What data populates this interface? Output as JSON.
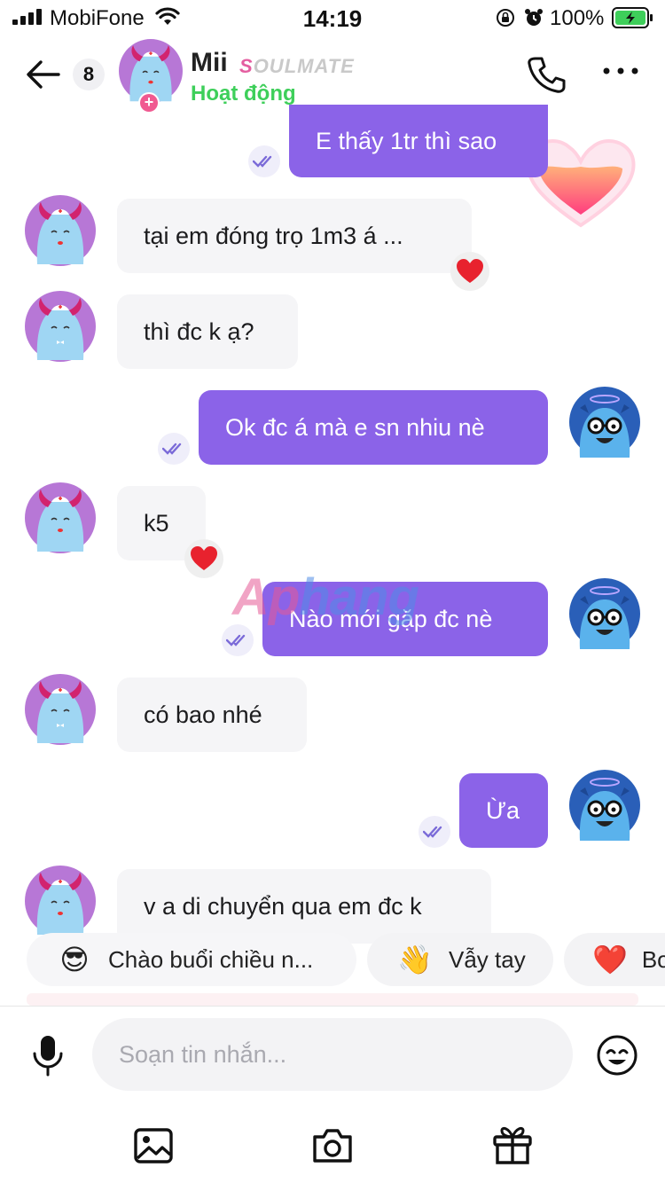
{
  "status_bar": {
    "carrier": "MobiFone",
    "time": "14:19",
    "battery": "100%"
  },
  "header": {
    "unread_count": "8",
    "name": "Mii",
    "tag_prefix": "S",
    "tag_rest": "OULMATE",
    "status": "Hoạt động"
  },
  "messages": [
    {
      "side": "out",
      "text": "E thấy 1tr thì sao",
      "seen": true
    },
    {
      "side": "in",
      "text": "tại em đóng trọ 1m3 á ...",
      "reaction": "❤️"
    },
    {
      "side": "in",
      "text": "thì đc k ạ?"
    },
    {
      "side": "out",
      "text": "Ok đc á mà e sn nhiu nè",
      "seen": true
    },
    {
      "side": "in",
      "text": "k5",
      "reaction": "❤️"
    },
    {
      "side": "out",
      "text": "Nào mới gặp đc nè",
      "seen": true
    },
    {
      "side": "in",
      "text": "có bao nhé"
    },
    {
      "side": "out",
      "text": "Ừa",
      "seen": true
    },
    {
      "side": "in",
      "text": "v a di chuyển qua em đc k"
    }
  ],
  "watermark": {
    "part1": "Ap",
    "part2": "hang"
  },
  "quick_replies": [
    {
      "icon": "sun-sunglasses-icon",
      "emoji": "😎",
      "label": "Chào buổi chiều n..."
    },
    {
      "icon": "waving-hand-icon",
      "emoji": "👋",
      "label": "Vẫy tay"
    },
    {
      "icon": "heart-icon",
      "emoji": "❤️",
      "label": "Bo"
    }
  ],
  "composer": {
    "placeholder": "Soạn tin nhắn..."
  },
  "colors": {
    "accent": "#8b63e8",
    "online": "#3ecf5a",
    "incoming_bubble": "#f5f5f7"
  }
}
